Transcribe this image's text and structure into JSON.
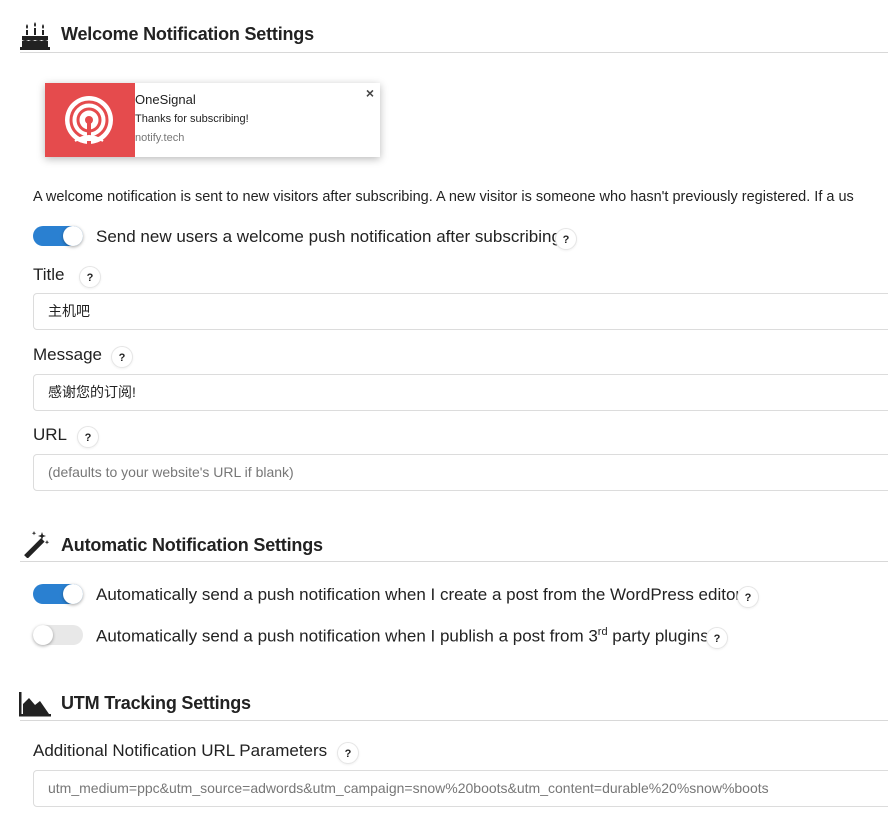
{
  "welcome": {
    "title": "Welcome Notification Settings",
    "preview": {
      "app_name": "OneSignal",
      "message": "Thanks for subscribing!",
      "host": "notify.tech",
      "close": "×",
      "brand_color": "#e54b4d"
    },
    "description": "A welcome notification is sent to new visitors after subscribing. A new visitor is someone who hasn't previously registered. If a us",
    "toggle_label": "Send new users a welcome push notification after subscribing",
    "toggle_on": true,
    "title_label": "Title",
    "title_value": "主机吧",
    "message_label": "Message",
    "message_value": "感谢您的订阅!",
    "url_label": "URL",
    "url_placeholder": "(defaults to your website's URL if blank)"
  },
  "automatic": {
    "title": "Automatic Notification Settings",
    "toggle1_label": "Automatically send a push notification when I create a post from the WordPress editor",
    "toggle1_on": true,
    "toggle2_prefix": "Automatically send a push notification when I publish a post from 3",
    "toggle2_sup": "rd",
    "toggle2_suffix": " party plugins",
    "toggle2_on": false
  },
  "utm": {
    "title": "UTM Tracking Settings",
    "params_label": "Additional Notification URL Parameters",
    "params_placeholder": "utm_medium=ppc&utm_source=adwords&utm_campaign=snow%20boots&utm_content=durable%20%snow%boots"
  },
  "help_glyph": "?",
  "icons": {
    "welcome": "birthday-cake-icon",
    "automatic": "magic-wand-icon",
    "utm": "area-chart-icon"
  },
  "colors": {
    "toggle_on": "#2a80d1",
    "toggle_off": "#e8e8e8"
  }
}
